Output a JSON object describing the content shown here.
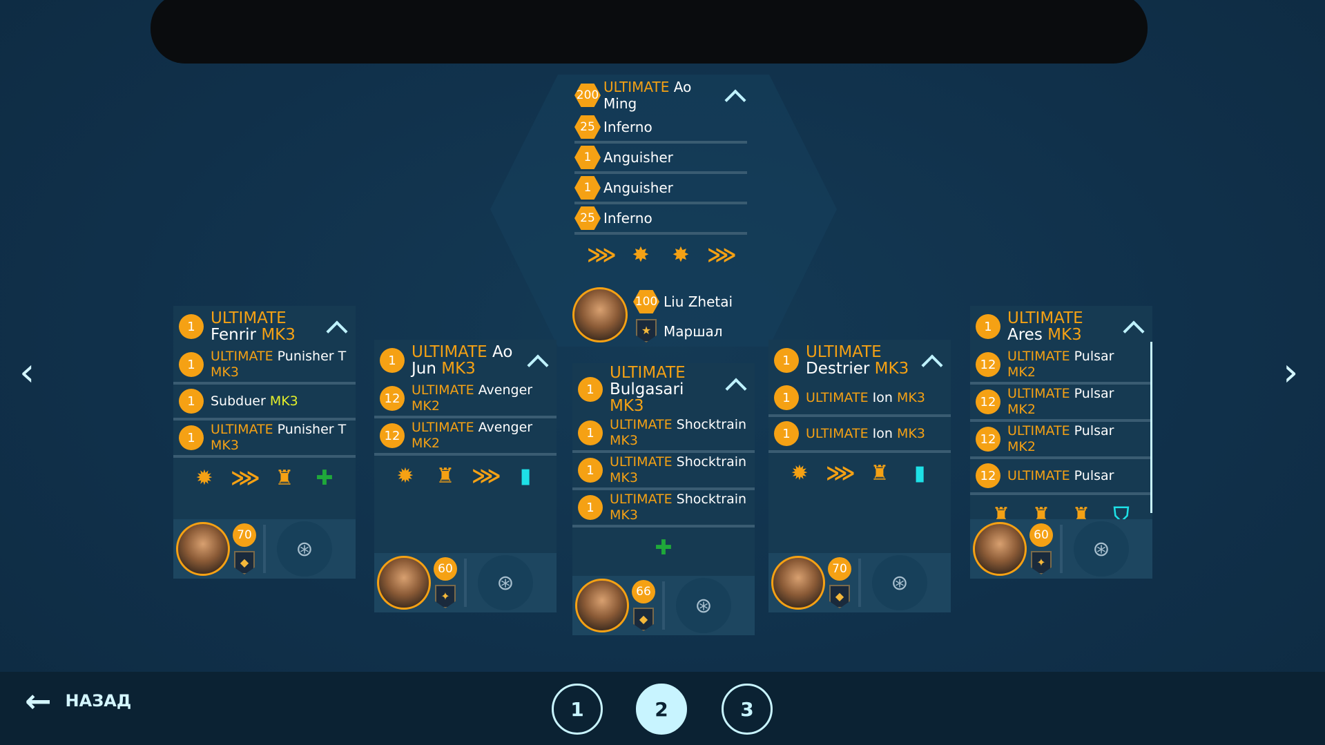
{
  "colors": {
    "accent": "#f5a114",
    "mk_yellow": "#e4ef2a",
    "cyan": "#1ee0e6",
    "green": "#1fa83a",
    "background": "#10304a"
  },
  "center": {
    "rows": [
      {
        "badge": "200",
        "prefix": "ULTIMATE",
        "name": "Ao Ming",
        "suffix": "",
        "sep": false
      },
      {
        "badge": "25",
        "prefix": "",
        "name": "Inferno",
        "suffix": "",
        "sep": true
      },
      {
        "badge": "1",
        "prefix": "",
        "name": "Anguisher",
        "suffix": "",
        "sep": true
      },
      {
        "badge": "1",
        "prefix": "",
        "name": "Anguisher",
        "suffix": "",
        "sep": true
      },
      {
        "badge": "25",
        "prefix": "",
        "name": "Inferno",
        "suffix": "",
        "sep": true
      }
    ],
    "icons": [
      "chevrons-plus-icon",
      "burst-mech-icon",
      "burst-mech-icon",
      "chevrons-plus-icon"
    ],
    "commander": {
      "level": "100",
      "name": "Liu Zhetai",
      "rank": "Маршал"
    }
  },
  "cards": [
    {
      "header": {
        "badge": "1",
        "prefix": "ULTIMATE",
        "name": "Fenrir",
        "suffix": "MK3"
      },
      "rows": [
        {
          "badge": "1",
          "prefix": "ULTIMATE",
          "name": "Punisher T",
          "suffix": "MK3",
          "suffix_color": "orange"
        },
        {
          "badge": "1",
          "prefix": "",
          "name": "Subduer",
          "suffix": "MK3",
          "suffix_color": "yellow"
        },
        {
          "badge": "1",
          "prefix": "ULTIMATE",
          "name": "Punisher T",
          "suffix": "MK3",
          "suffix_color": "orange"
        }
      ],
      "icons": [
        "burst-arrow-icon",
        "chevrons-plus-icon",
        "mech-repair-icon",
        "green-heal-icon"
      ],
      "pilot_level": "70",
      "rank": "diamond"
    },
    {
      "header": {
        "badge": "1",
        "prefix": "ULTIMATE",
        "name": "Ao Jun",
        "suffix": "MK3"
      },
      "rows": [
        {
          "badge": "12",
          "prefix": "ULTIMATE",
          "name": "Avenger",
          "suffix": "MK2",
          "suffix_color": "orange"
        },
        {
          "badge": "12",
          "prefix": "ULTIMATE",
          "name": "Avenger",
          "suffix": "MK2",
          "suffix_color": "orange"
        }
      ],
      "icons": [
        "burst-arrow-icon",
        "mech-repair-icon",
        "chevrons-plus-icon",
        "cyan-mech-icon"
      ],
      "pilot_level": "60",
      "rank": "three-stars"
    },
    {
      "header": {
        "badge": "1",
        "prefix": "ULTIMATE",
        "name": "Bulgasari",
        "suffix": "MK3"
      },
      "rows": [
        {
          "badge": "1",
          "prefix": "ULTIMATE",
          "name": "Shocktrain",
          "suffix": "MK3",
          "suffix_color": "orange"
        },
        {
          "badge": "1",
          "prefix": "ULTIMATE",
          "name": "Shocktrain",
          "suffix": "MK3",
          "suffix_color": "orange"
        },
        {
          "badge": "1",
          "prefix": "ULTIMATE",
          "name": "Shocktrain",
          "suffix": "MK3",
          "suffix_color": "orange"
        }
      ],
      "icons": [
        "green-heal-icon"
      ],
      "pilot_level": "66",
      "rank": "diamond"
    },
    {
      "header": {
        "badge": "1",
        "prefix": "ULTIMATE",
        "name": "Destrier",
        "suffix": "MK3"
      },
      "rows": [
        {
          "badge": "1",
          "prefix": "ULTIMATE",
          "name": "Ion",
          "suffix": "MK3",
          "suffix_color": "orange"
        },
        {
          "badge": "1",
          "prefix": "ULTIMATE",
          "name": "Ion",
          "suffix": "MK3",
          "suffix_color": "orange"
        }
      ],
      "icons": [
        "burst-arrow-icon",
        "chevrons-plus-icon",
        "mech-repair-icon",
        "cyan-mech-icon"
      ],
      "pilot_level": "70",
      "rank": "diamond"
    },
    {
      "header": {
        "badge": "1",
        "prefix": "ULTIMATE",
        "name": "Ares",
        "suffix": "MK3"
      },
      "rows": [
        {
          "badge": "12",
          "prefix": "ULTIMATE",
          "name": "Pulsar",
          "suffix": "MK2",
          "suffix_color": "orange"
        },
        {
          "badge": "12",
          "prefix": "ULTIMATE",
          "name": "Pulsar",
          "suffix": "MK2",
          "suffix_color": "orange"
        },
        {
          "badge": "12",
          "prefix": "ULTIMATE",
          "name": "Pulsar",
          "suffix": "MK2",
          "suffix_color": "orange"
        },
        {
          "badge": "12",
          "prefix": "ULTIMATE",
          "name": "Pulsar",
          "suffix": "",
          "suffix_color": "orange"
        }
      ],
      "icons": [
        "mech-repair-icon",
        "mech-repair-icon",
        "mech-repair-icon",
        "cyan-shield-icon"
      ],
      "pilot_level": "60",
      "rank": "three-stars"
    }
  ],
  "footer": {
    "back_label": "НАЗАД",
    "pages": [
      "1",
      "2",
      "3"
    ],
    "active_page": "2"
  }
}
